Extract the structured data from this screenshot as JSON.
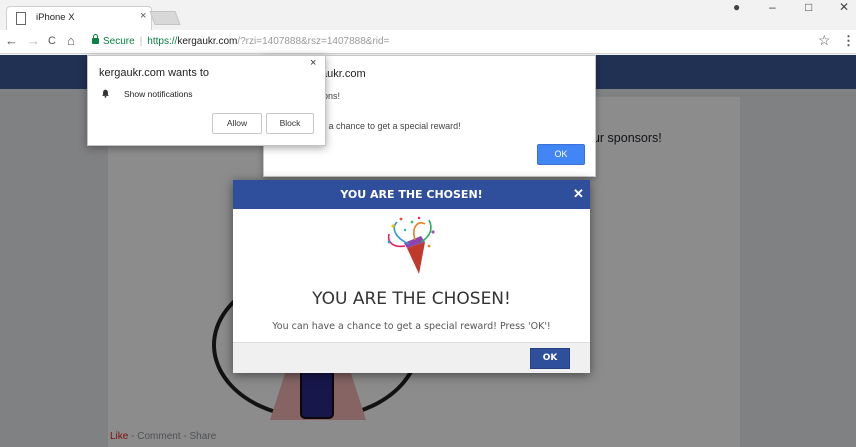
{
  "browser": {
    "tab_title": "iPhone X",
    "tab_close": "×",
    "window_controls": {
      "account": "●",
      "minimize": "–",
      "maximize": "□",
      "close": "✕"
    },
    "nav": {
      "back": "←",
      "forward": "→",
      "reload": "C",
      "home": "⌂"
    },
    "secure_label": "Secure",
    "url_scheme": "https://",
    "url_host": "kergaukr.com",
    "url_path": "/?rzi=1407888&rsz=1407888&rid=",
    "star": "☆",
    "menu": "⋮"
  },
  "page": {
    "sponsors_text": "our sponsors!",
    "social_like": "Like",
    "social_rest": " - Comment - Share"
  },
  "alert_dialog": {
    "title": "aukr.com",
    "subtitle": "ions!",
    "message": "e a chance to get a special reward!",
    "ok_label": "OK"
  },
  "permission_popup": {
    "title": "kergaukr.com wants to",
    "close": "×",
    "permission_text": "Show notifications",
    "allow_label": "Allow",
    "block_label": "Block"
  },
  "modal": {
    "header_title": "YOU ARE THE CHOSEN!",
    "close": "✕",
    "heading": "YOU ARE THE CHOSEN!",
    "text": "You can have a chance to get a special reward! Press 'OK'!",
    "ok_label": "OK"
  },
  "colors": {
    "header_blue": "#3b5998",
    "modal_blue": "#2f4f9c",
    "secure_green": "#0b8043",
    "alert_ok_blue": "#4285f4"
  }
}
